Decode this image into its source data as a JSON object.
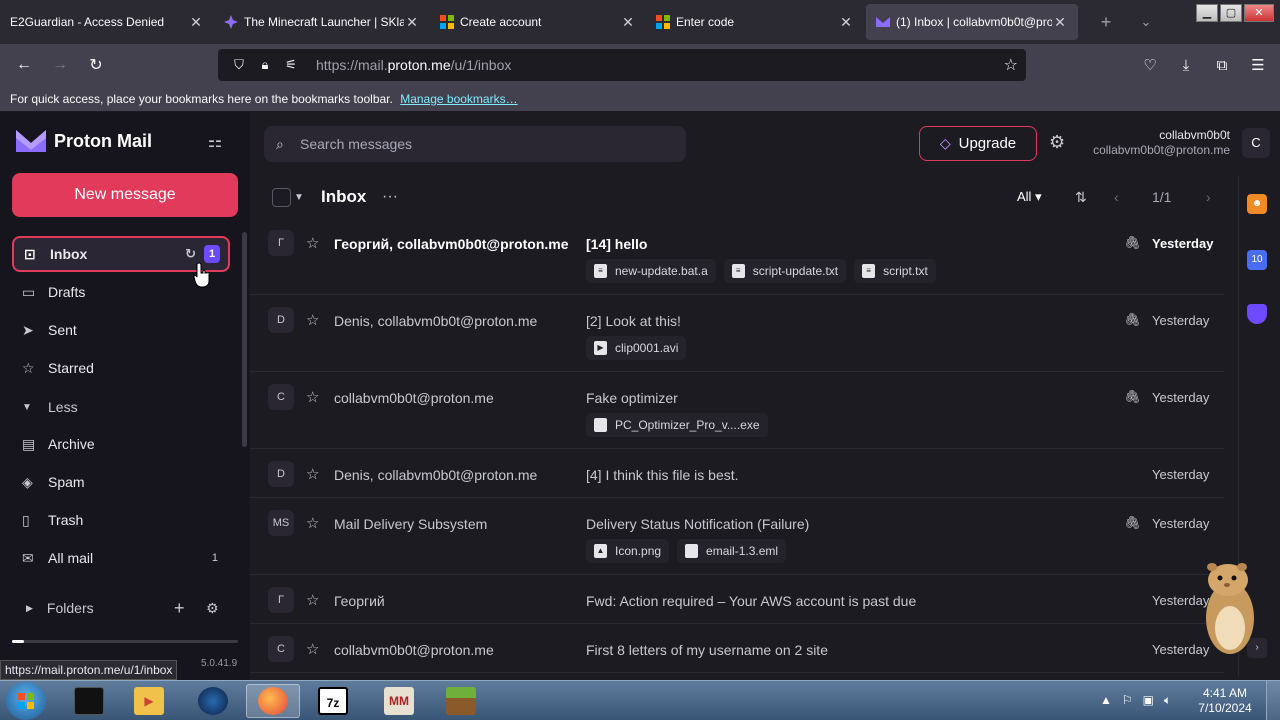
{
  "browser": {
    "tabs": [
      {
        "label": "E2Guardian - Access Denied",
        "favicon": "none",
        "close": "✕"
      },
      {
        "label": "The Minecraft Launcher | SKlau",
        "favicon": "sklauncher-icon",
        "close": "✕"
      },
      {
        "label": "Create account",
        "favicon": "microsoft-icon",
        "close": "✕"
      },
      {
        "label": "Enter code",
        "favicon": "microsoft-icon",
        "close": "✕"
      },
      {
        "label": "(1) Inbox | collabvm0b0t@prot",
        "favicon": "proton-mail-icon",
        "close": "✕",
        "active": true
      }
    ],
    "new_tab": "+",
    "tab_list": "⌄",
    "url_prefix": "https://mail.",
    "url_domain": "proton.me",
    "url_path": "/u/1/inbox",
    "bookmarks_text": "For quick access, place your bookmarks here on the bookmarks toolbar.",
    "bookmarks_link": "Manage bookmarks…",
    "status_url": "https://mail.proton.me/u/1/inbox"
  },
  "proton": {
    "brand": "Proton Mail",
    "new_message": "New message",
    "search_placeholder": "Search messages",
    "upgrade": "Upgrade",
    "account_name": "collabvm0b0t",
    "account_email": "collabvm0b0t@proton.me",
    "avatar_initial": "C",
    "version": "5.0.41.9",
    "sidebar": {
      "items": [
        {
          "label": "Inbox",
          "icon": "inbox-icon",
          "badge": "1"
        },
        {
          "label": "Drafts",
          "icon": "drafts-icon"
        },
        {
          "label": "Sent",
          "icon": "sent-icon"
        },
        {
          "label": "Starred",
          "icon": "star-icon"
        },
        {
          "label": "Less",
          "icon": "chevron-down-icon"
        },
        {
          "label": "Archive",
          "icon": "archive-icon"
        },
        {
          "label": "Spam",
          "icon": "spam-icon"
        },
        {
          "label": "Trash",
          "icon": "trash-icon"
        },
        {
          "label": "All mail",
          "icon": "all-mail-icon",
          "count": "1"
        }
      ],
      "folders": "Folders"
    },
    "toolbar": {
      "title": "Inbox",
      "filter": "All",
      "pager": "1/1"
    },
    "messages": [
      {
        "avatar": "Г",
        "sender": "Георгий, collabvm0b0t@proton.me",
        "subject": "[14] hello",
        "time": "Yesterday",
        "unread": true,
        "attachment": true,
        "attachments": [
          "new-update.bat.a",
          "script-update.txt",
          "script.txt"
        ]
      },
      {
        "avatar": "D",
        "sender": "Denis, collabvm0b0t@proton.me",
        "subject": "[2] Look at this!",
        "time": "Yesterday",
        "attachment": true,
        "attachments": [
          "clip0001.avi"
        ]
      },
      {
        "avatar": "C",
        "sender": "collabvm0b0t@proton.me",
        "subject": "Fake optimizer",
        "time": "Yesterday",
        "attachment": true,
        "attachments": [
          "PC_Optimizer_Pro_v....exe"
        ]
      },
      {
        "avatar": "D",
        "sender": "Denis, collabvm0b0t@proton.me",
        "subject": "[4] I think this file is best.",
        "time": "Yesterday",
        "attachment": false,
        "attachments": []
      },
      {
        "avatar": "MS",
        "sender": "Mail Delivery Subsystem",
        "subject": "Delivery Status Notification (Failure)",
        "time": "Yesterday",
        "attachment": true,
        "attachments": [
          "Icon.png",
          "email-1.3.eml"
        ]
      },
      {
        "avatar": "Г",
        "sender": "Георгий",
        "subject": "Fwd: Action required – Your AWS account is past due",
        "time": "Yesterday",
        "attachment": false,
        "attachments": []
      },
      {
        "avatar": "C",
        "sender": "collabvm0b0t@proton.me",
        "subject": "First 8 letters of my username on 2 site",
        "time": "Yesterday",
        "attachment": false,
        "attachments": []
      }
    ]
  },
  "taskbar": {
    "clock_time": "4:41 AM",
    "clock_date": "7/10/2024",
    "apps": [
      "terminal-icon",
      "media-player-icon",
      "globe-icon",
      "firefox-icon",
      "7zip-icon",
      "multimc-icon",
      "minecraft-icon"
    ],
    "app_7zip": "7z",
    "app_multimc": "MM"
  },
  "colors": {
    "accent": "#e23a5b",
    "badge": "#6d4aff",
    "app_bg": "#1c1b22",
    "sidebar_bg": "#16141c"
  }
}
